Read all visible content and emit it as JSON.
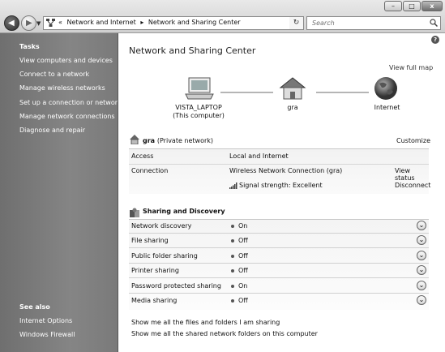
{
  "address": {
    "crumbs": [
      "Network and Internet",
      "Network and Sharing Center"
    ],
    "search_placeholder": "Search"
  },
  "window_buttons": {
    "min": "–",
    "max": "□",
    "close": "x"
  },
  "left_pane": {
    "tasks_heading": "Tasks",
    "tasks": [
      "View computers and devices",
      "Connect to a network",
      "Manage wireless networks",
      "Set up a connection or network",
      "Manage network connections",
      "Diagnose and repair"
    ],
    "see_also_heading": "See also",
    "see_also": [
      "Internet Options",
      "Windows Firewall"
    ]
  },
  "main": {
    "title": "Network and Sharing Center",
    "view_full_map": "View full map",
    "map": {
      "computer_name": "VISTA_LAPTOP",
      "computer_sub": "(This computer)",
      "network_name": "gra",
      "internet": "Internet"
    },
    "network": {
      "name": "gra",
      "type": "(Private network)",
      "customize": "Customize",
      "rows": [
        {
          "key": "Access",
          "value": "Local and Internet",
          "action": ""
        },
        {
          "key": "Connection",
          "value": "Wireless Network Connection (gra)",
          "action": "View status"
        },
        {
          "key": "",
          "value": "Signal strength:  Excellent",
          "action": "Disconnect"
        }
      ]
    },
    "sharing": {
      "heading": "Sharing and Discovery",
      "rows": [
        {
          "key": "Network discovery",
          "value": "On"
        },
        {
          "key": "File sharing",
          "value": "Off"
        },
        {
          "key": "Public folder sharing",
          "value": "Off"
        },
        {
          "key": "Printer sharing",
          "value": "Off"
        },
        {
          "key": "Password protected sharing",
          "value": "On"
        },
        {
          "key": "Media sharing",
          "value": "Off"
        }
      ]
    },
    "bottom_links": [
      "Show me all the files and folders I am sharing",
      "Show me all the shared network folders on this computer"
    ],
    "help": "?"
  }
}
